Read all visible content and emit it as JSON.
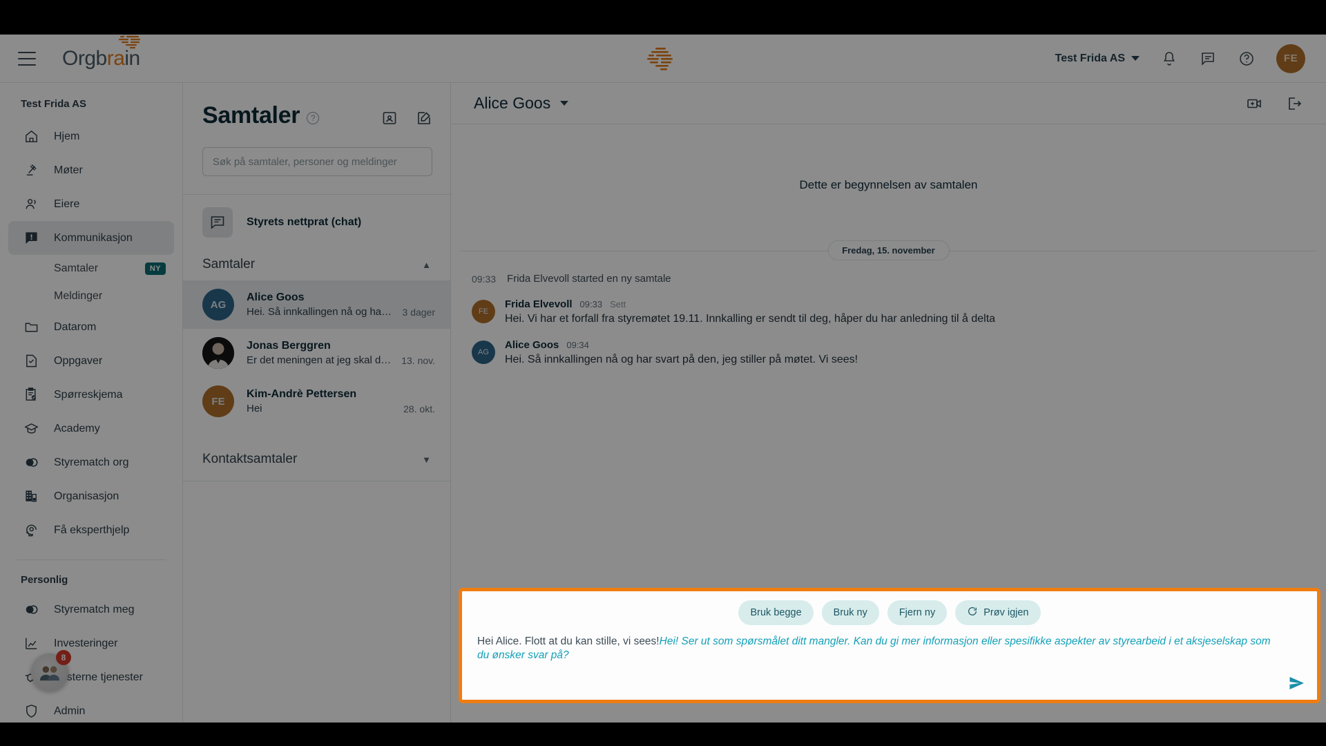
{
  "header": {
    "brand_first": "Orgb",
    "brand_accent": "ra",
    "brand_last": "in",
    "org_switcher": "Test Frida AS",
    "avatar_initials": "FE",
    "icons": [
      "bell-icon",
      "chat-icon",
      "help-icon"
    ]
  },
  "sidebar": {
    "org": "Test Frida AS",
    "items": [
      {
        "label": "Hjem",
        "icon": "home-icon"
      },
      {
        "label": "Møter",
        "icon": "gavel-icon"
      },
      {
        "label": "Eiere",
        "icon": "people-icon"
      },
      {
        "label": "Kommunikasjon",
        "icon": "alert-chat-icon",
        "active": true
      },
      {
        "label": "Datarom",
        "icon": "folder-icon"
      },
      {
        "label": "Oppgaver",
        "icon": "task-icon"
      },
      {
        "label": "Spørreskjema",
        "icon": "clipboard-check-icon"
      },
      {
        "label": "Academy",
        "icon": "graduation-icon"
      },
      {
        "label": "Styrematch org",
        "icon": "venn-icon"
      },
      {
        "label": "Organisasjon",
        "icon": "building-gear-icon"
      },
      {
        "label": "Få eksperthjelp",
        "icon": "head-gear-icon"
      }
    ],
    "subitems": [
      {
        "label": "Samtaler",
        "badge": "NY"
      },
      {
        "label": "Meldinger",
        "badge": ""
      }
    ],
    "personal_section": "Personlig",
    "personal_items": [
      {
        "label": "Styrematch meg",
        "icon": "venn-icon"
      },
      {
        "label": "Investeringer",
        "icon": "chart-icon"
      },
      {
        "label": "Eksterne tjenester",
        "icon": "handshake-icon"
      },
      {
        "label": "Admin",
        "icon": "shield-icon"
      }
    ],
    "help_badge_count": "8"
  },
  "conversations": {
    "title": "Samtaler",
    "help_icon": "question-circle-icon",
    "header_icons": [
      "contacts-icon",
      "compose-icon"
    ],
    "search_placeholder": "Søk på samtaler, personer og meldinger",
    "search_value": "",
    "pinned": {
      "label": "Styrets nettprat (chat)",
      "icon": "chat-box-icon"
    },
    "group_label": "Samtaler",
    "group_label_2": "Kontaktsamtaler",
    "items": [
      {
        "name": "Alice Goos",
        "preview": "Hei. Så innkallingen nå og har s…",
        "time": "3 dager",
        "initials": "AG",
        "style": "ag",
        "selected": true
      },
      {
        "name": "Jonas Berggren",
        "preview": "Er det meningen at jeg skal delt…",
        "time": "13. nov.",
        "initials": "",
        "style": "photo",
        "selected": false
      },
      {
        "name": "Kim-Andrè Pettersen",
        "preview": "Hei",
        "time": "28. okt.",
        "initials": "FE",
        "style": "fe",
        "selected": false
      }
    ]
  },
  "chat": {
    "title": "Alice Goos",
    "head_icons": [
      "add-video-icon",
      "leave-icon"
    ],
    "begin_note": "Dette er begynnelsen av samtalen",
    "date_separator": "Fredag, 15. november",
    "system_event": {
      "time": "09:33",
      "text": "Frida Elvevoll started en ny samtale"
    },
    "messages": [
      {
        "avatar": "FE",
        "avatar_style": "fe",
        "name": "Frida Elvevoll",
        "time": "09:33",
        "status": "Sett",
        "text": "Hei. Vi har et forfall fra styremøtet 19.11. Innkalling er sendt til deg, håper du har anledning til å delta"
      },
      {
        "avatar": "AG",
        "avatar_style": "ag",
        "name": "Alice Goos",
        "time": "09:34",
        "status": "",
        "text": "Hei. Så innkallingen nå og har svart på den, jeg stiller på møtet. Vi sees!"
      }
    ]
  },
  "composer": {
    "actions": [
      {
        "label": "Bruk begge",
        "icon": ""
      },
      {
        "label": "Bruk ny",
        "icon": ""
      },
      {
        "label": "Fjern ny",
        "icon": ""
      },
      {
        "label": "Prøv igjen",
        "icon": "refresh-icon"
      }
    ],
    "typed_text": "Hei Alice. Flott at du kan stille, vi sees!",
    "suggestion_text": "Hei! Ser ut som spørsmålet ditt mangler. Kan du gi mer informasjon eller spesifikke aspekter av styrearbeid i et aksjeselskap som du ønsker svar på?",
    "send_icon": "send-icon",
    "highlight_color": "#f07c10"
  },
  "colors": {
    "accent_orange": "#e07b18",
    "highlight_border": "#f07c10",
    "badge_teal": "#0b6e74",
    "suggestion_cyan": "#13a0b8",
    "chip_bg": "#d8ecec",
    "avatar_blue": "#2d6489",
    "avatar_brown": "#b0702a"
  }
}
